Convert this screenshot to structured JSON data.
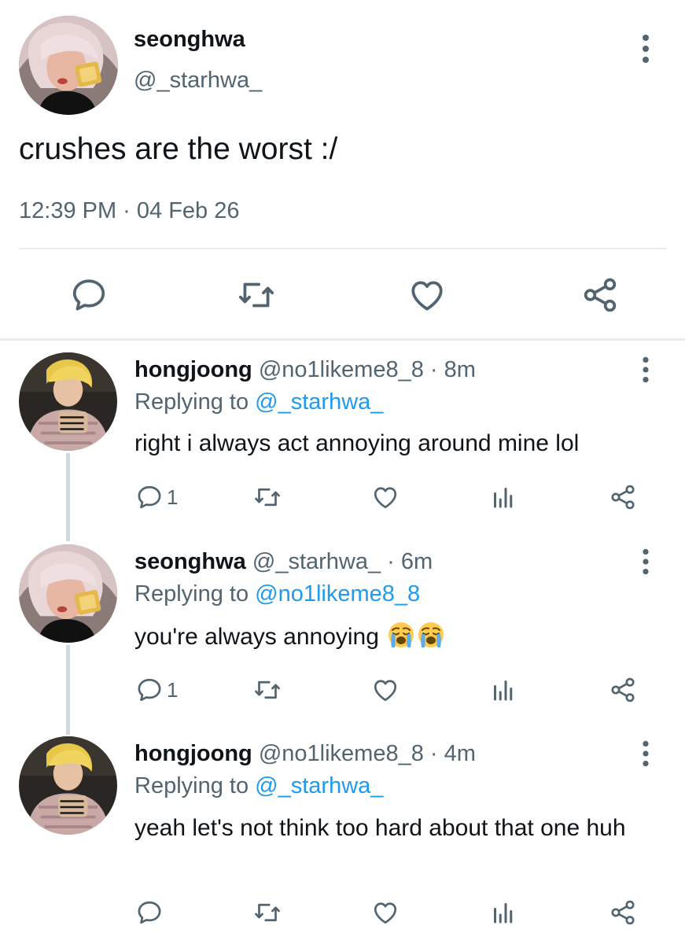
{
  "main_tweet": {
    "display_name": "seonghwa",
    "handle": "@_starhwa_",
    "text": "crushes are the worst :/",
    "timestamp": "12:39 PM · 04 Feb 26",
    "actions": [
      "reply-icon",
      "retweet-icon",
      "like-icon",
      "share-icon"
    ]
  },
  "replies": [
    {
      "display_name": "hongjoong",
      "handle": "@no1likeme8_8",
      "time": " · 8m",
      "replying_prefix": "Replying to ",
      "replying_to": "@_starhwa_",
      "text": "right i always act annoying around mine lol",
      "reply_count": "1",
      "retweet_count": "",
      "like_count": ""
    },
    {
      "display_name": "seonghwa",
      "handle": "@_starhwa_",
      "time": " · 6m",
      "replying_prefix": "Replying to ",
      "replying_to": "@no1likeme8_8",
      "text": "you're always annoying",
      "emoji": [
        "loudly-crying-face",
        "loudly-crying-face"
      ],
      "reply_count": "1",
      "retweet_count": "",
      "like_count": ""
    },
    {
      "display_name": "hongjoong",
      "handle": "@no1likeme8_8",
      "time": " · 4m",
      "replying_prefix": "Replying to ",
      "replying_to": "@_starhwa_",
      "text": "yeah let's not think too hard about that one huh",
      "reply_count": "",
      "retweet_count": "",
      "like_count": ""
    }
  ],
  "colors": {
    "text": "#0f1419",
    "secondary": "#536471",
    "link": "#1d9bf0",
    "divider": "#e6ecf0",
    "thread_line": "#cfd9de"
  }
}
